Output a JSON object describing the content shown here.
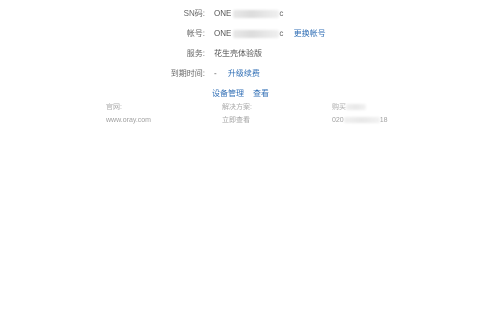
{
  "info": {
    "sn": {
      "label": "SN码:",
      "value_prefix": "ONE",
      "value_suffix": "c"
    },
    "account": {
      "label": "帐号:",
      "value_prefix": "ONE",
      "value_suffix": "c",
      "action_label": "更换帐号"
    },
    "service": {
      "label": "服务:",
      "value": "花生壳体验版"
    },
    "expire": {
      "label": "到期时间:",
      "value": "-",
      "action_label": "升级续费"
    }
  },
  "actions": {
    "device_manage_label": "设备管理",
    "view_label": "查看"
  },
  "bottom": {
    "website": {
      "header": "官网:",
      "value": "www.oray.com"
    },
    "solution": {
      "header": "解决方案:",
      "value": "立即查看"
    },
    "purchase": {
      "header_prefix": "购买",
      "value_prefix": "020",
      "value_suffix": "18"
    }
  },
  "colors": {
    "link": "#2f6eb5",
    "label": "#666666",
    "muted": "#a8a8a8",
    "background": "#ffffff"
  }
}
